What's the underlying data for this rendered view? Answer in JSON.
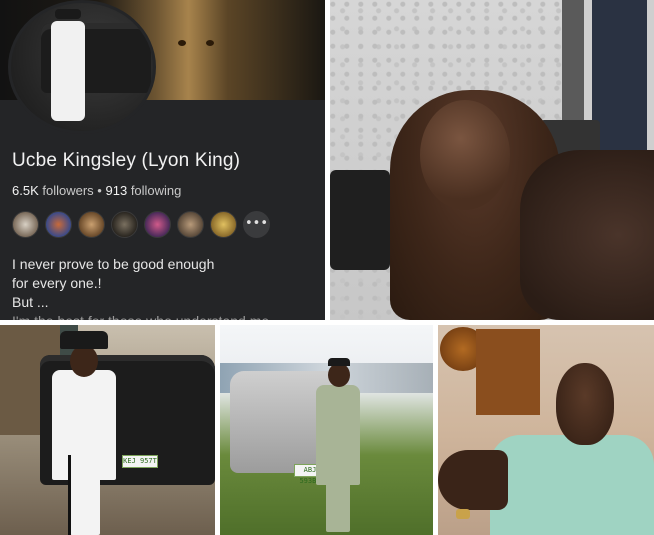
{
  "profile": {
    "name": "Ucbe Kingsley (Lyon King)",
    "followers_count": "6.5K",
    "followers_label": "followers",
    "separator": "•",
    "following_count": "913",
    "following_label": "following",
    "more_label": "•••",
    "bio_lines": [
      "I never prove to be good enough",
      "for every one.!",
      "But ...",
      "I'm the best for those who understand me"
    ]
  },
  "photo1": {
    "plate": "KEJ 957T"
  },
  "photo2": {
    "plate": "ABJ 593BI"
  },
  "colors": {
    "card_bg": "#242527",
    "text_primary": "#f2f2f2",
    "text_secondary": "#c9c9c9"
  }
}
